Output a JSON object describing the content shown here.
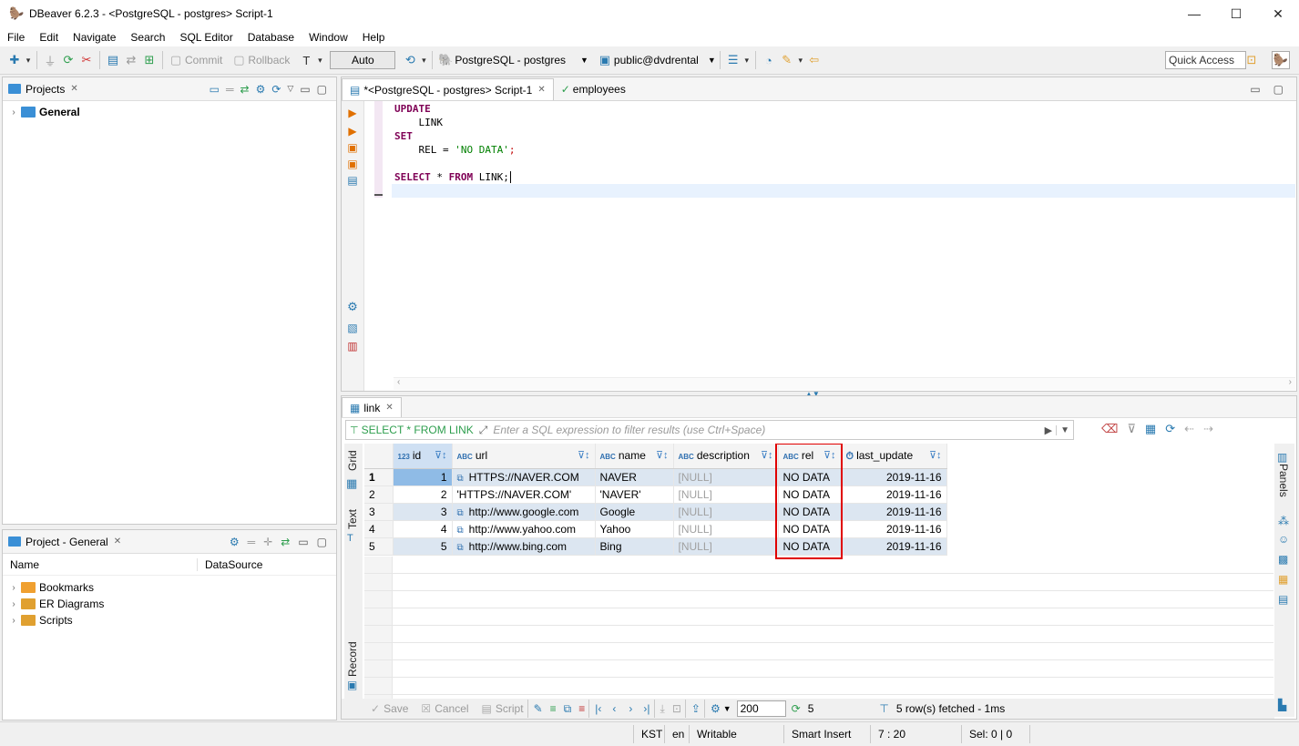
{
  "window": {
    "title": "DBeaver 6.2.3 - <PostgreSQL - postgres> Script-1",
    "minimize": "—",
    "maximize": "☐",
    "close": "✕"
  },
  "menu": [
    "File",
    "Edit",
    "Navigate",
    "Search",
    "SQL Editor",
    "Database",
    "Window",
    "Help"
  ],
  "toolbar": {
    "commit": "Commit",
    "rollback": "Rollback",
    "auto": "Auto",
    "connection": "PostgreSQL - postgres",
    "schema": "public@dvdrental",
    "quick_access": "Quick Access"
  },
  "projects_panel": {
    "title": "Projects",
    "items": [
      {
        "label": "General"
      }
    ]
  },
  "project_general_panel": {
    "title": "Project - General",
    "columns": [
      "Name",
      "DataSource"
    ],
    "items": [
      {
        "label": "Bookmarks",
        "color": "#f0a030"
      },
      {
        "label": "ER Diagrams",
        "color": "#e0a030"
      },
      {
        "label": "Scripts",
        "color": "#e0a030"
      }
    ]
  },
  "editor": {
    "tabs": [
      {
        "label": "*<PostgreSQL - postgres> Script-1"
      },
      {
        "label": "employees"
      }
    ],
    "lines": {
      "l1": "UPDATE",
      "l2": "    LINK",
      "l3": "SET",
      "l4_a": "    REL = ",
      "l4_b": "'NO DATA'",
      "l4_c": ";",
      "l6_a": "SELECT",
      "l6_b": " * ",
      "l6_c": "FROM",
      "l6_d": " LINK;"
    }
  },
  "results": {
    "tab": "link",
    "query_label": "SELECT * FROM LINK",
    "filter_placeholder": "Enter a SQL expression to filter results (use Ctrl+Space)",
    "side_tabs": {
      "grid": "Grid",
      "text": "Text",
      "record": "Record",
      "panels": "Panels"
    },
    "columns": [
      {
        "type": "123",
        "name": "id"
      },
      {
        "type": "ABC",
        "name": "url"
      },
      {
        "type": "ABC",
        "name": "name"
      },
      {
        "type": "ABC",
        "name": "description"
      },
      {
        "type": "ABC",
        "name": "rel"
      },
      {
        "type": "⏱",
        "name": "last_update"
      }
    ],
    "rows": [
      {
        "num": "1",
        "id": "1",
        "url": "HTTPS://NAVER.COM",
        "name": "NAVER",
        "description": "[NULL]",
        "rel": "NO DATA",
        "last_update": "2019-11-16"
      },
      {
        "num": "2",
        "id": "2",
        "url": "'HTTPS://NAVER.COM'",
        "name": "'NAVER'",
        "description": "[NULL]",
        "rel": "NO DATA",
        "last_update": "2019-11-16"
      },
      {
        "num": "3",
        "id": "3",
        "url": "http://www.google.com",
        "name": "Google",
        "description": "[NULL]",
        "rel": "NO DATA",
        "last_update": "2019-11-16"
      },
      {
        "num": "4",
        "id": "4",
        "url": "http://www.yahoo.com",
        "name": "Yahoo",
        "description": "[NULL]",
        "rel": "NO DATA",
        "last_update": "2019-11-16"
      },
      {
        "num": "5",
        "id": "5",
        "url": "http://www.bing.com",
        "name": "Bing",
        "description": "[NULL]",
        "rel": "NO DATA",
        "last_update": "2019-11-16"
      }
    ],
    "bottom": {
      "save": "Save",
      "cancel": "Cancel",
      "script": "Script",
      "fetch_size": "200",
      "row_count": "5",
      "fetched": "5 row(s) fetched - 1ms"
    },
    "highlight_color": "#e00000"
  },
  "statusbar": {
    "tz": "KST",
    "lang": "en",
    "mode": "Writable",
    "insert": "Smart Insert",
    "pos": "7 : 20",
    "sel": "Sel: 0 | 0"
  }
}
